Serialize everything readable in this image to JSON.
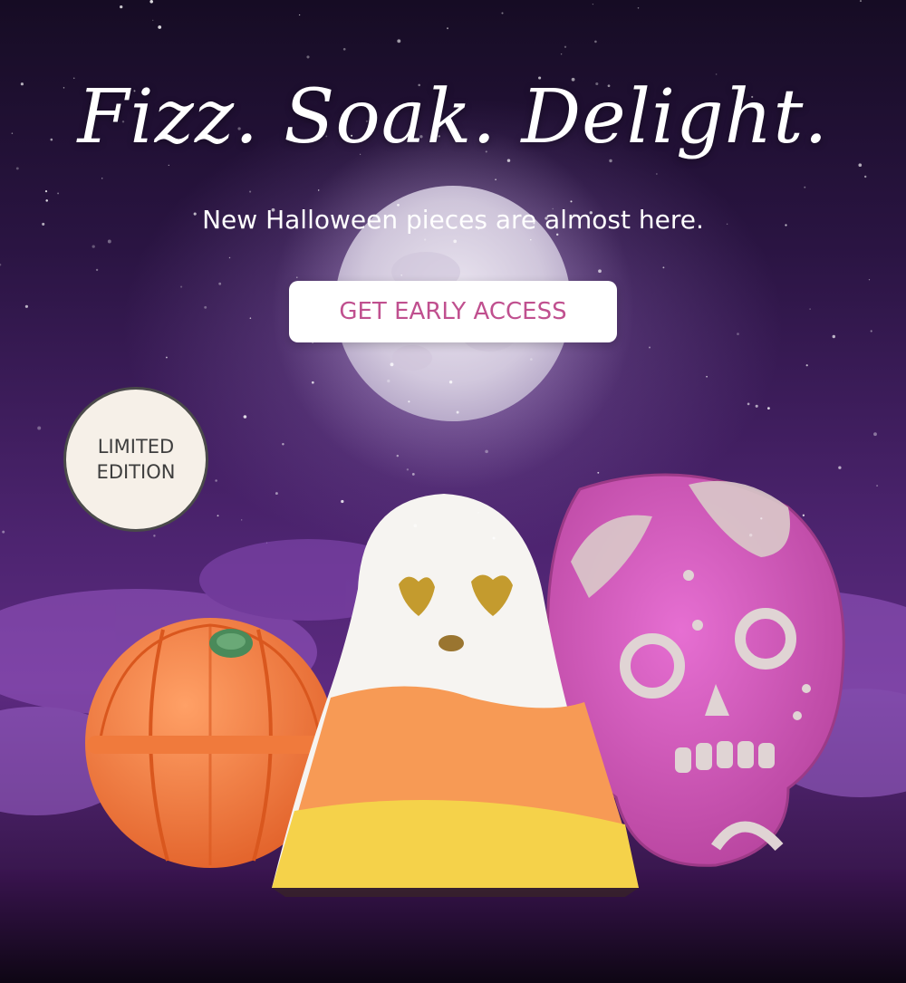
{
  "hero": {
    "headline": "Fizz. Soak. Delight.",
    "subheadline": "New Halloween pieces are almost here.",
    "cta_label": "GET EARLY ACCESS",
    "cta_color": "#c0508f",
    "background_color": "#4d2470"
  },
  "badge": {
    "line1": "LIMITED",
    "line2": "EDITION"
  },
  "products": {
    "pumpkin": "pumpkin-bath-bomb",
    "ghost": "candy-corn-ghost-bath-bomb",
    "skull": "pink-sugar-skull-bath-bomb"
  }
}
